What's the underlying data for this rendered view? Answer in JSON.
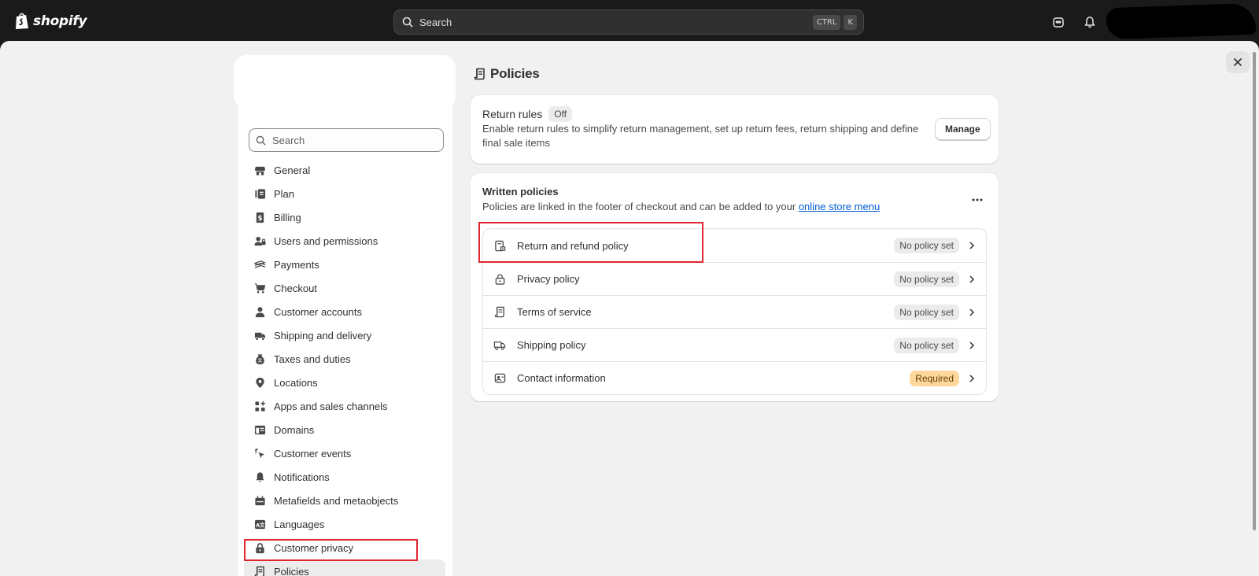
{
  "topbar": {
    "brand": "shopify",
    "search_label": "Search",
    "shortcut_keys": [
      "CTRL",
      "K"
    ]
  },
  "sidebar": {
    "search_placeholder": "Search",
    "items": [
      {
        "label": "General",
        "icon": "store-icon"
      },
      {
        "label": "Plan",
        "icon": "plan-icon"
      },
      {
        "label": "Billing",
        "icon": "billing-icon"
      },
      {
        "label": "Users and permissions",
        "icon": "users-icon"
      },
      {
        "label": "Payments",
        "icon": "payments-icon"
      },
      {
        "label": "Checkout",
        "icon": "cart-icon"
      },
      {
        "label": "Customer accounts",
        "icon": "person-icon"
      },
      {
        "label": "Shipping and delivery",
        "icon": "truck-icon"
      },
      {
        "label": "Taxes and duties",
        "icon": "taxes-icon"
      },
      {
        "label": "Locations",
        "icon": "location-pin-icon"
      },
      {
        "label": "Apps and sales channels",
        "icon": "apps-icon"
      },
      {
        "label": "Domains",
        "icon": "domains-icon"
      },
      {
        "label": "Customer events",
        "icon": "cursor-click-icon"
      },
      {
        "label": "Notifications",
        "icon": "bell-icon"
      },
      {
        "label": "Metafields and metaobjects",
        "icon": "metafields-icon"
      },
      {
        "label": "Languages",
        "icon": "language-icon"
      },
      {
        "label": "Customer privacy",
        "icon": "lock-icon"
      },
      {
        "label": "Policies",
        "icon": "policy-scroll-icon",
        "active": true
      }
    ]
  },
  "main": {
    "title": "Policies",
    "return_rules": {
      "title": "Return rules",
      "status": "Off",
      "description": "Enable return rules to simplify return management, set up return fees, return shipping and define final sale items",
      "button": "Manage"
    },
    "written_policies": {
      "title": "Written policies",
      "description": "Policies are linked in the footer of checkout and can be added to your",
      "link_text": "online store menu",
      "rows": [
        {
          "label": "Return and refund policy",
          "badge": "No policy set",
          "icon": "return-receipt-icon"
        },
        {
          "label": "Privacy policy",
          "badge": "No policy set",
          "icon": "lock-icon"
        },
        {
          "label": "Terms of service",
          "badge": "No policy set",
          "icon": "policy-scroll-icon"
        },
        {
          "label": "Shipping policy",
          "badge": "No policy set",
          "icon": "truck-icon"
        },
        {
          "label": "Contact information",
          "badge": "Required",
          "icon": "contact-card-icon",
          "badge_style": "warning"
        }
      ]
    }
  },
  "colors": {
    "topbar": "#1a1a1a",
    "page_bg": "#f1f1f1",
    "link": "#005bd3",
    "highlight": "#e0262f",
    "required_badge": "#ffd79d"
  }
}
